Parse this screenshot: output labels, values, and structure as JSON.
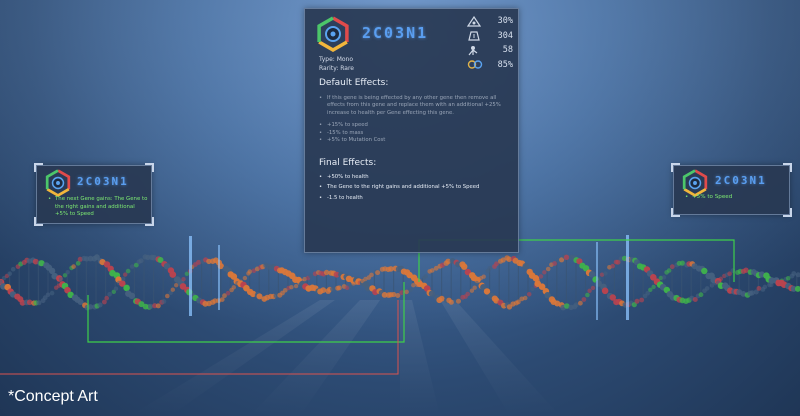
{
  "colors": {
    "gene_name": "#5a9ef0",
    "effect_green": "#7dea72",
    "connector_green": "#3ecf4a",
    "connector_red": "#d9534f",
    "dna_orange": "#d9773a",
    "dna_red": "#b9434f",
    "dna_green": "#3fb34b",
    "dna_blue": "#45607f"
  },
  "main_tooltip": {
    "gene_name": "2C03N1",
    "logo_icon": "hexagon-gene-icon",
    "stats": [
      {
        "icon": "mutation-chance-icon",
        "value": "30%"
      },
      {
        "icon": "mass-icon",
        "value": "304"
      },
      {
        "icon": "cost-icon",
        "value": "58"
      },
      {
        "icon": "compatibility-icon",
        "value": "85%"
      }
    ],
    "type_line": "Type: Mono",
    "rarity_line": "Rarity: Rare",
    "default_title": "Default Effects:",
    "default_effects": [
      "If this gene is being effected by any other gene then remove all effects from this gene and replace them with an additional +25% increase to health per Gene effecting this gene.",
      "+15% to speed",
      "-15% to mass",
      "+5% to Mutation Cost"
    ],
    "final_title": "Final Effects:",
    "final_effects": [
      "+50% to health",
      "The Gene to the right gains and additional +5% to Speed",
      "-1.5 to health"
    ]
  },
  "left_tooltip": {
    "gene_name": "2C03N1",
    "logo_icon": "hexagon-gene-icon",
    "effects": [
      "The next Gene gains: The Gene to the right gains and additional +5% to Speed"
    ]
  },
  "right_tooltip": {
    "gene_name": "2C03N1",
    "logo_icon": "hexagon-gene-icon",
    "effects": [
      "+5% to Speed"
    ]
  },
  "caption": "*Concept Art"
}
